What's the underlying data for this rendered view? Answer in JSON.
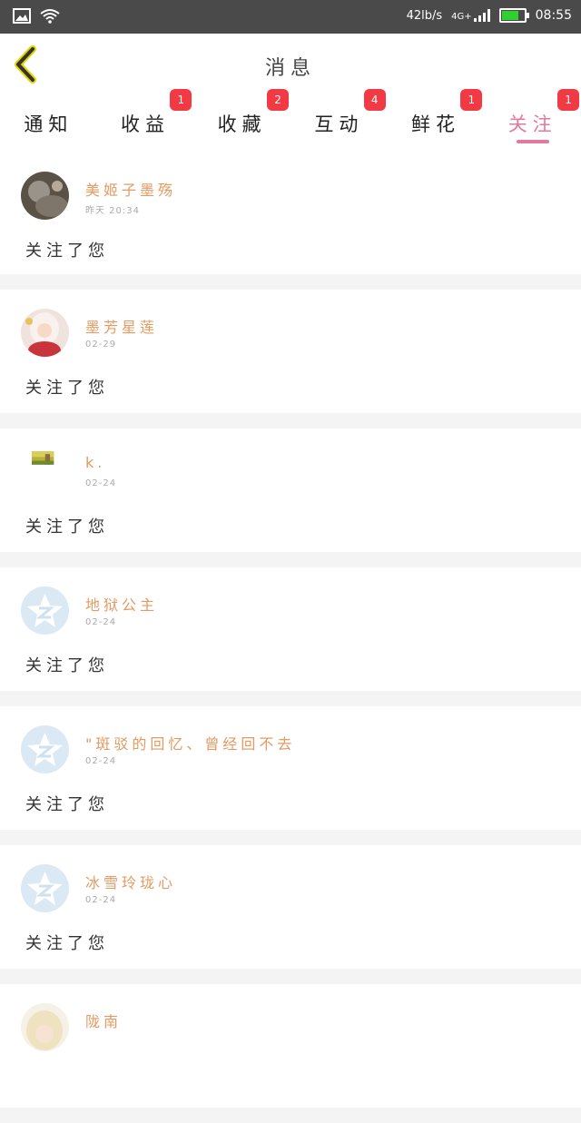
{
  "status_bar": {
    "net_speed": "42lb/s",
    "network": "4G+",
    "time": "08:55",
    "battery_level": 0.85,
    "icons": [
      "image-icon",
      "wifi-icon",
      "signal-icon",
      "battery-icon"
    ]
  },
  "header": {
    "title": "消息",
    "back_icon": "chevron-left-icon",
    "accent": "#e6d400"
  },
  "tabs": [
    {
      "label": "通知",
      "badge": "",
      "active": false
    },
    {
      "label": "收益",
      "badge": "1",
      "active": false
    },
    {
      "label": "收藏",
      "badge": "2",
      "active": false
    },
    {
      "label": "互动",
      "badge": "4",
      "active": false
    },
    {
      "label": "鲜花",
      "badge": "1",
      "active": false
    },
    {
      "label": "关注",
      "badge": "1",
      "active": true
    }
  ],
  "colors": {
    "active_tab": "#e27a9e",
    "badge": "#f23a44",
    "name": "#e49a63"
  },
  "items": [
    {
      "name": "美姬子墨殇",
      "time": "昨天 20:34",
      "message": "关注了您",
      "avatar": "photo-avatar"
    },
    {
      "name": "墨芳星莲",
      "time": "02-29",
      "message": "关注了您",
      "avatar": "anime-avatar"
    },
    {
      "name": "k.",
      "time": "02-24",
      "message": "关注了您",
      "avatar": "landscape-avatar"
    },
    {
      "name": "地狱公主",
      "time": "02-24",
      "message": "关注了您",
      "avatar": "default-avatar"
    },
    {
      "name": "\"斑驳的回忆、曾经回不去",
      "time": "02-24",
      "message": "关注了您",
      "avatar": "default-avatar"
    },
    {
      "name": "冰雪玲珑心",
      "time": "02-24",
      "message": "关注了您",
      "avatar": "default-avatar"
    },
    {
      "name": "陇南",
      "time": "",
      "message": "",
      "avatar": "anime-avatar"
    }
  ]
}
